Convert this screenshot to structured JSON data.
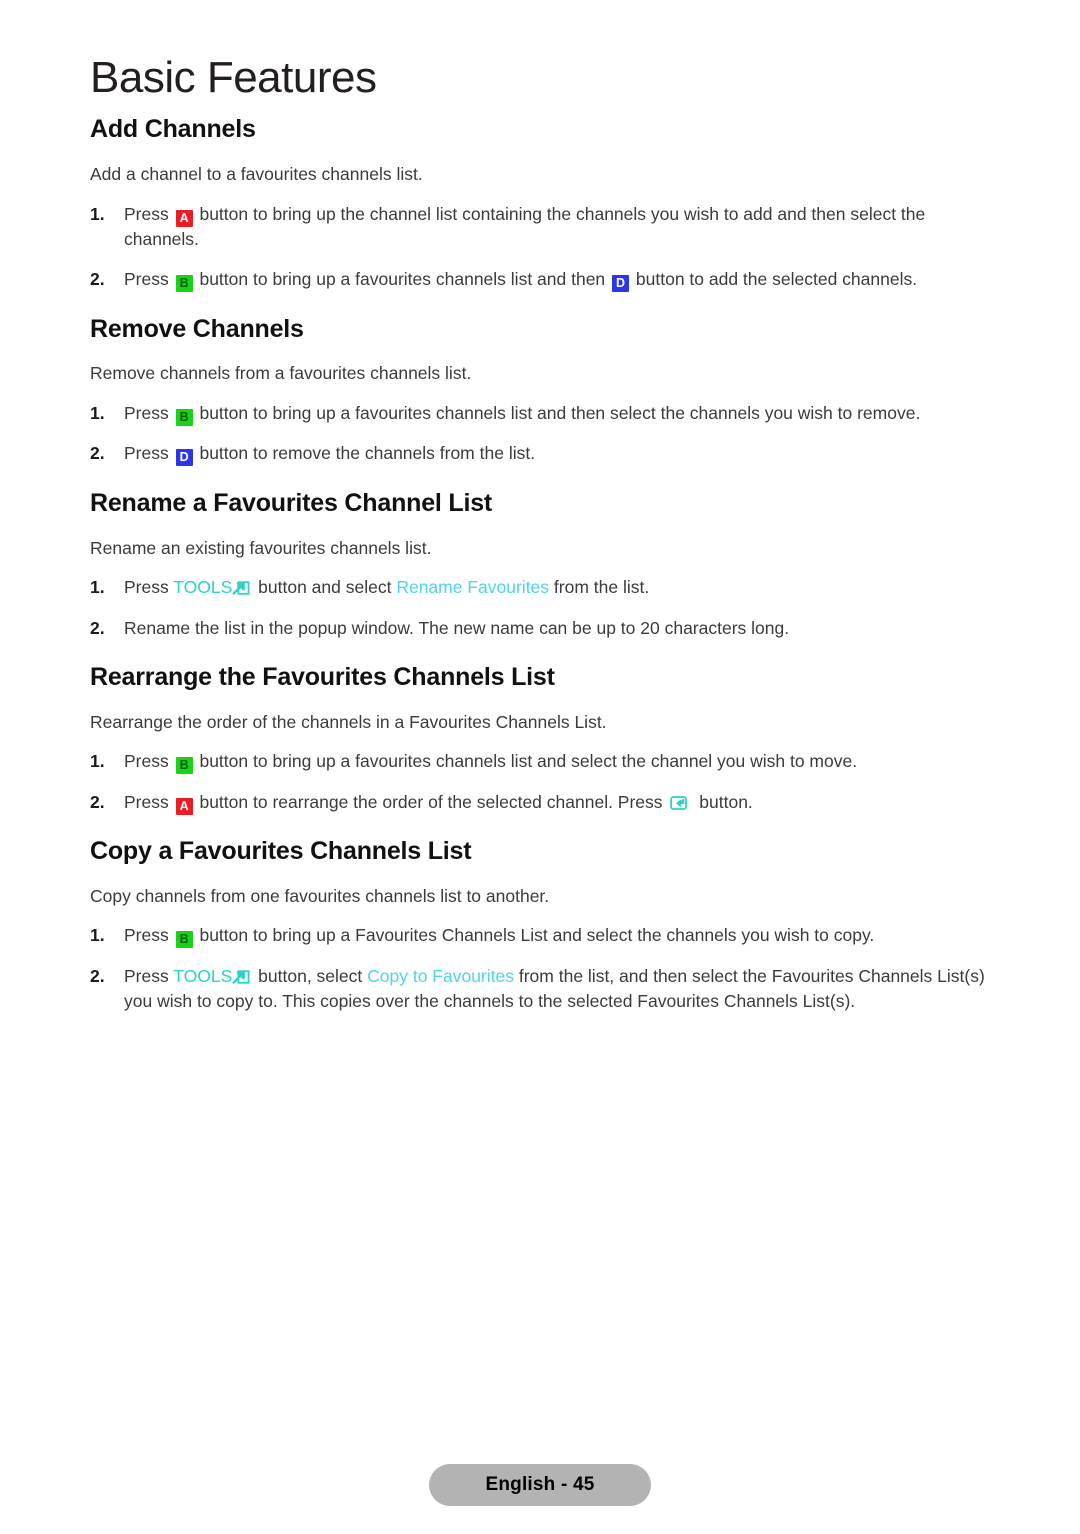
{
  "page": {
    "title": "Basic Features",
    "footer_label": "English - 45"
  },
  "colors": {
    "key_a_bg": "#ed1c24",
    "key_a_fg": "#ffffff",
    "key_b_bg": "#18d318",
    "key_b_fg": "#0a5c0a",
    "key_d_bg": "#2b35ea",
    "key_d_fg": "#ffffff",
    "tools_cyan": "#2ad3c3",
    "menu_cyan": "#4fd2ef",
    "footer_pill": "#b3b3b3",
    "body_text": "#3b3b3b",
    "heading_text": "#111111"
  },
  "keys": {
    "a": "A",
    "b": "B",
    "d": "D",
    "tools": "TOOLS"
  },
  "icons": {
    "tools": "tools-arrow-icon",
    "enter": "enter-return-icon"
  },
  "sections": [
    {
      "heading": "Add Channels",
      "intro": "Add a channel to a favourites channels list.",
      "steps": [
        {
          "num": "1.",
          "parts": [
            {
              "t": "text",
              "v": "Press "
            },
            {
              "t": "key",
              "v": "A"
            },
            {
              "t": "text",
              "v": " button to bring up the channel list containing the channels you wish to add and then select the channels."
            }
          ]
        },
        {
          "num": "2.",
          "parts": [
            {
              "t": "text",
              "v": "Press "
            },
            {
              "t": "key",
              "v": "B"
            },
            {
              "t": "text",
              "v": " button to bring up a favourites channels list and then "
            },
            {
              "t": "key",
              "v": "D"
            },
            {
              "t": "text",
              "v": " button to add the selected channels."
            }
          ]
        }
      ]
    },
    {
      "heading": "Remove Channels",
      "intro": "Remove channels from a favourites channels list.",
      "steps": [
        {
          "num": "1.",
          "parts": [
            {
              "t": "text",
              "v": "Press "
            },
            {
              "t": "key",
              "v": "B"
            },
            {
              "t": "text",
              "v": " button to bring up a favourites channels list and then select the channels you wish to remove."
            }
          ]
        },
        {
          "num": "2.",
          "parts": [
            {
              "t": "text",
              "v": "Press "
            },
            {
              "t": "key",
              "v": "D"
            },
            {
              "t": "text",
              "v": " button to remove the channels from the list."
            }
          ]
        }
      ]
    },
    {
      "heading": "Rename a Favourites Channel List",
      "intro": "Rename an existing favourites channels list.",
      "steps": [
        {
          "num": "1.",
          "parts": [
            {
              "t": "text",
              "v": "Press "
            },
            {
              "t": "tools",
              "v": "TOOLS"
            },
            {
              "t": "text",
              "v": " button and select "
            },
            {
              "t": "menu",
              "v": "Rename Favourites"
            },
            {
              "t": "text",
              "v": " from the list."
            }
          ]
        },
        {
          "num": "2.",
          "parts": [
            {
              "t": "text",
              "v": "Rename the list in the popup window. The new name can be up to 20 characters long."
            }
          ]
        }
      ]
    },
    {
      "heading": "Rearrange the Favourites Channels List",
      "intro": "Rearrange the order of the channels in a Favourites Channels List.",
      "steps": [
        {
          "num": "1.",
          "parts": [
            {
              "t": "text",
              "v": "Press "
            },
            {
              "t": "key",
              "v": "B"
            },
            {
              "t": "text",
              "v": " button to bring up a favourites channels list and select the channel you wish to move."
            }
          ]
        },
        {
          "num": "2.",
          "parts": [
            {
              "t": "text",
              "v": "Press "
            },
            {
              "t": "key",
              "v": "A"
            },
            {
              "t": "text",
              "v": " button to rearrange the order of the selected channel. Press "
            },
            {
              "t": "enter",
              "v": ""
            },
            {
              "t": "text",
              "v": " button."
            }
          ]
        }
      ]
    },
    {
      "heading": "Copy a Favourites Channels List",
      "intro": "Copy channels from one favourites channels list to another.",
      "steps": [
        {
          "num": "1.",
          "parts": [
            {
              "t": "text",
              "v": "Press "
            },
            {
              "t": "key",
              "v": "B"
            },
            {
              "t": "text",
              "v": " button to bring up a Favourites Channels List and select the channels you wish to copy."
            }
          ]
        },
        {
          "num": "2.",
          "parts": [
            {
              "t": "text",
              "v": "Press "
            },
            {
              "t": "tools",
              "v": "TOOLS"
            },
            {
              "t": "text",
              "v": " button, select "
            },
            {
              "t": "menu",
              "v": "Copy to Favourites"
            },
            {
              "t": "text",
              "v": " from the list, and then select the Favourites Channels List(s) you wish to copy to. This copies over the channels to the selected Favourites Channels List(s)."
            }
          ]
        }
      ]
    }
  ]
}
